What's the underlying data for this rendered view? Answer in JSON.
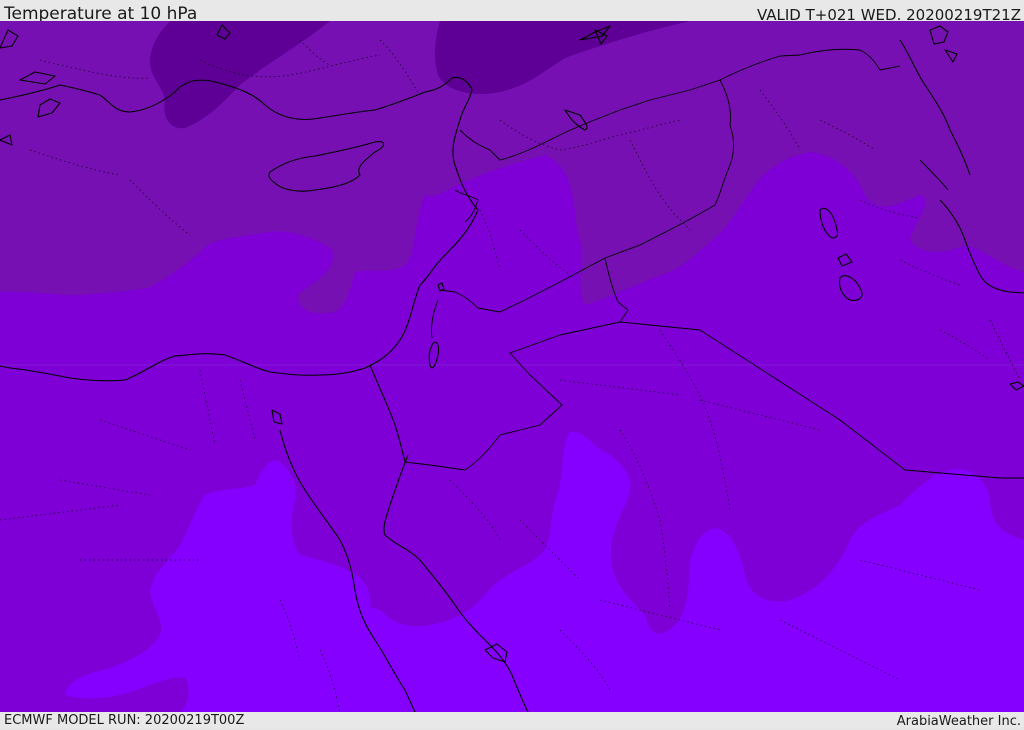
{
  "header": {
    "title": "Temperature at 10 hPa",
    "valid_text": "VALID T+021 WED. 20200219T21Z"
  },
  "footer": {
    "model_run": "ECMWF MODEL RUN: 20200219T00Z",
    "credit": "ArabiaWeather Inc."
  },
  "colors": {
    "band_darkest": "#5e0096",
    "band_dark": "#7610b2",
    "band_mid": "#7e00d6",
    "band_light": "#8600ff",
    "coastline": "#000000"
  }
}
